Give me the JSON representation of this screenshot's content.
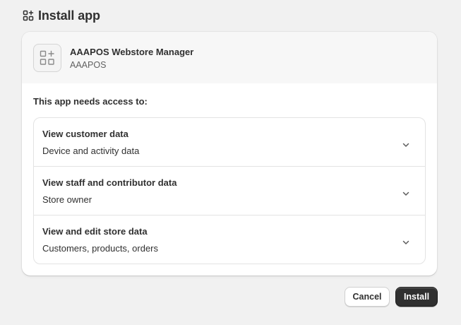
{
  "header": {
    "title": "Install app",
    "icon": "apps-icon"
  },
  "app": {
    "name": "AAAPOS Webstore Manager",
    "developer": "AAAPOS",
    "logo_icon": "app-placeholder-icon"
  },
  "access": {
    "title": "This app needs access to:",
    "permissions": [
      {
        "title": "View customer data",
        "description": "Device and activity data"
      },
      {
        "title": "View staff and contributor data",
        "description": "Store owner"
      },
      {
        "title": "View and edit store data",
        "description": "Customers, products, orders"
      }
    ]
  },
  "actions": {
    "cancel_label": "Cancel",
    "install_label": "Install"
  },
  "colors": {
    "background": "#f1f1f1",
    "card": "#ffffff",
    "primary_button": "#303030",
    "text": "#303030"
  }
}
